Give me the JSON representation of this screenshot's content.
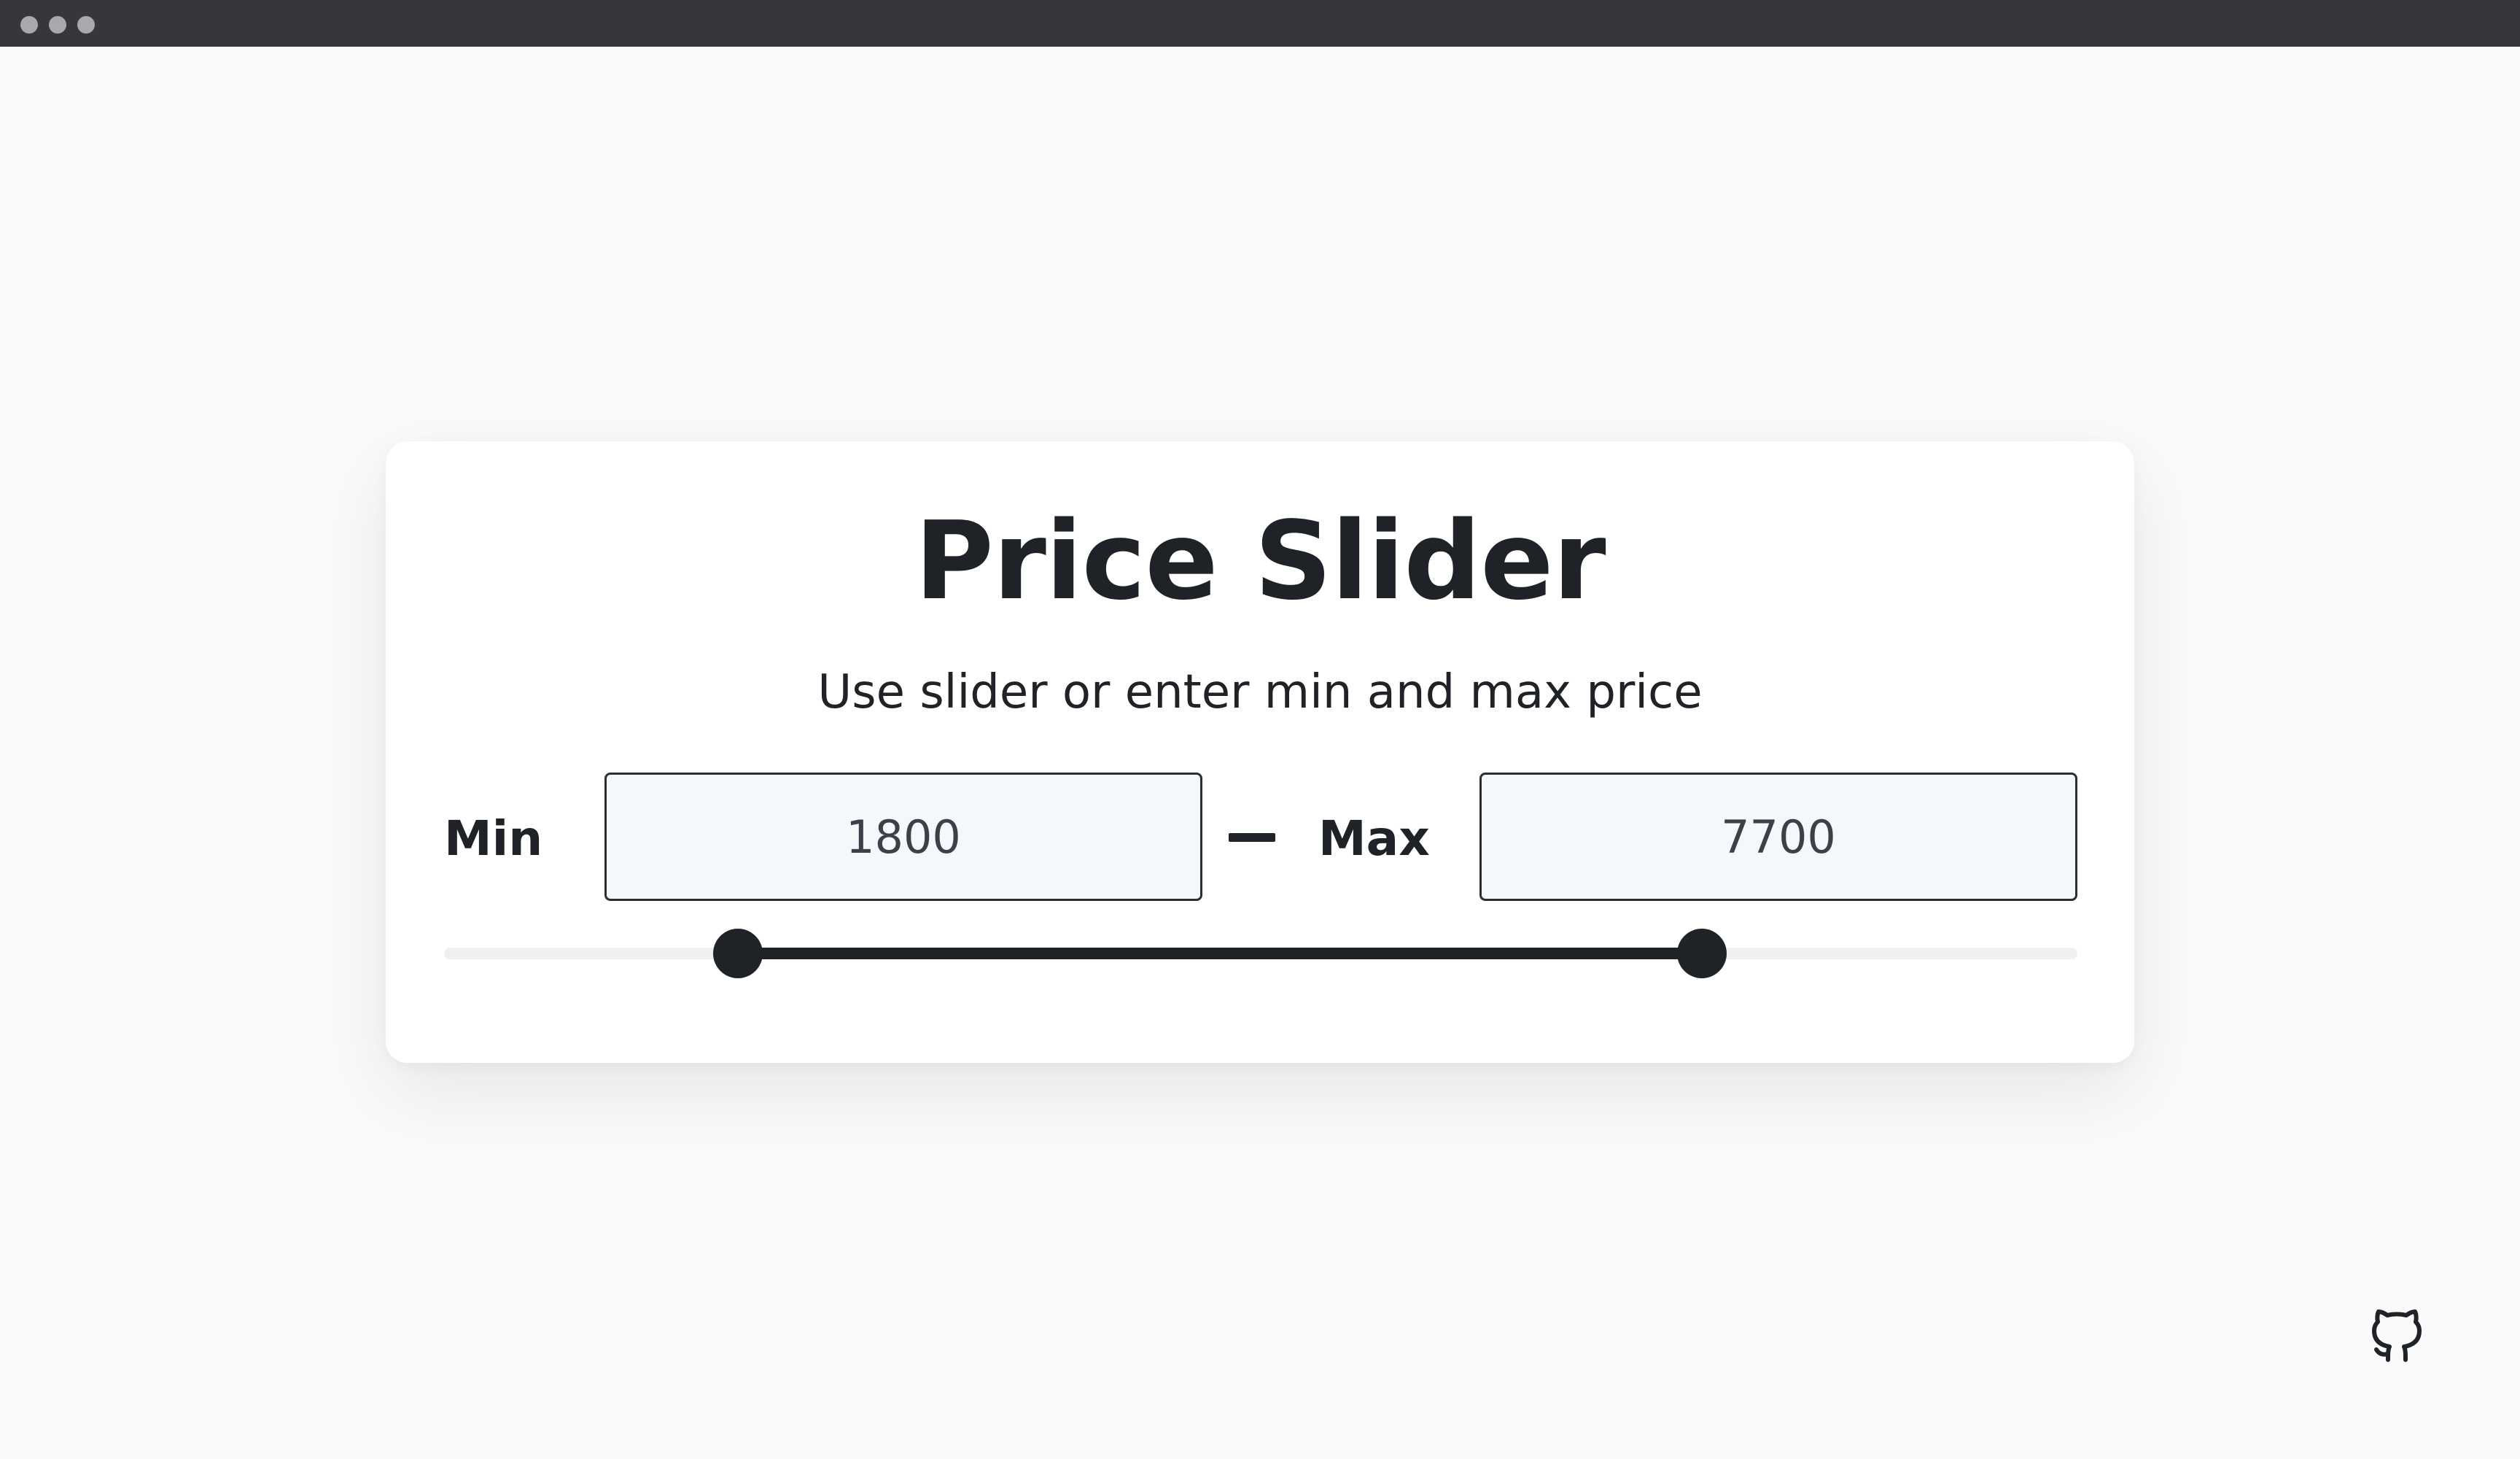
{
  "window": {
    "controls": [
      "window-dot",
      "window-dot",
      "window-dot"
    ]
  },
  "card": {
    "title": "Price Slider",
    "subtitle": "Use slider or enter min and max price"
  },
  "inputs": {
    "min_label": "Min",
    "min_value": "1800",
    "max_label": "Max",
    "max_value": "7700"
  },
  "slider": {
    "range_min": 0,
    "range_max": 10000,
    "low_value": 1800,
    "high_value": 7700,
    "track_color": "#efefef",
    "fill_color": "#1f2226"
  },
  "footer": {
    "github_icon": "github-icon"
  },
  "colors": {
    "background": "#fafafa",
    "titlebar": "#35373a",
    "text": "#1f2226",
    "input_background": "#f5f8fb"
  }
}
